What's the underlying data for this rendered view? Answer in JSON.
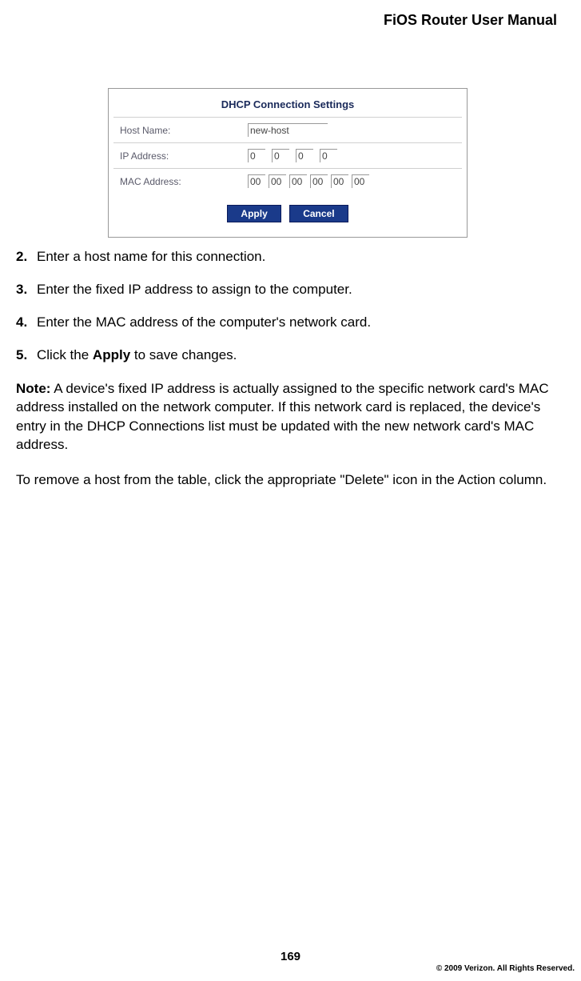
{
  "header": {
    "title": "FiOS Router User Manual"
  },
  "figure": {
    "panel_title": "DHCP Connection Settings",
    "rows": {
      "host": {
        "label": "Host Name:",
        "value": "new-host"
      },
      "ip": {
        "label": "IP Address:",
        "oct": [
          "0",
          "0",
          "0",
          "0"
        ]
      },
      "mac": {
        "label": "MAC Address:",
        "oct": [
          "00",
          "00",
          "00",
          "00",
          "00",
          "00"
        ]
      }
    },
    "buttons": {
      "apply": "Apply",
      "cancel": "Cancel"
    }
  },
  "steps": [
    {
      "num": "2.",
      "text": "Enter a host name for this connection."
    },
    {
      "num": "3.",
      "text": "Enter the fixed IP address to assign to the computer."
    },
    {
      "num": "4.",
      "text": "Enter the MAC address of the computer's network card."
    },
    {
      "num": "5.",
      "text_pre": "Click the ",
      "bold": "Apply",
      "text_post": " to save changes."
    }
  ],
  "note": {
    "label": "Note:",
    "text": " A device's fixed IP address is actually assigned to the specific network card's MAC address installed on the network computer. If this network card is replaced, the device's entry in the DHCP Connections list must be updated with the new network card's MAC address."
  },
  "para_remove": "To remove a host from the table, click the appropriate \"Delete\" icon in the Action column.",
  "footer": {
    "page": "169",
    "copyright": "© 2009 Verizon. All Rights Reserved."
  }
}
